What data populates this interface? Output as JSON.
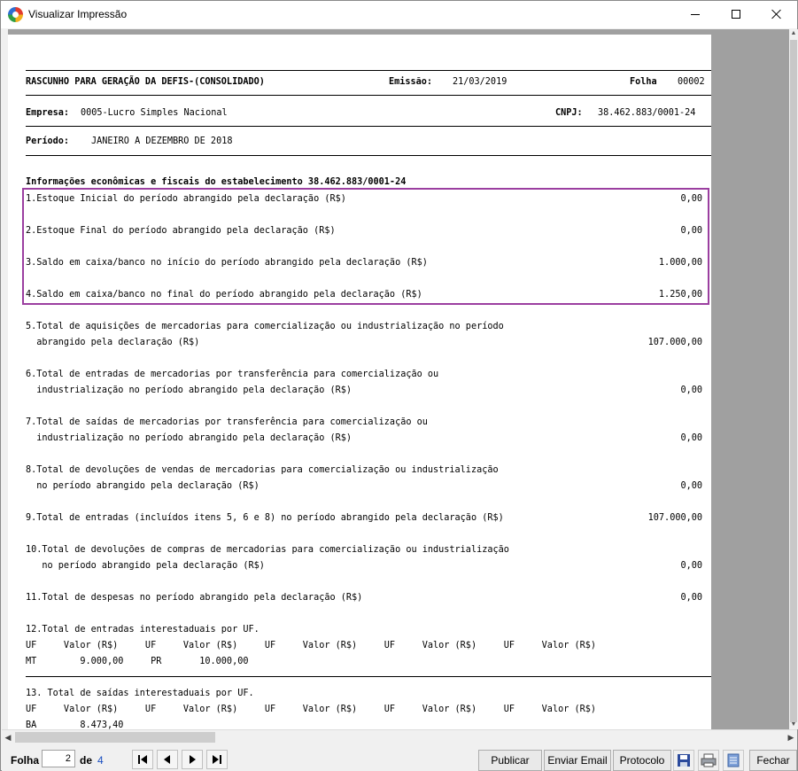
{
  "window": {
    "title": "Visualizar Impressão"
  },
  "report": {
    "header": {
      "title": "RASCUNHO PARA GERAÇÃO DA DEFIS-(CONSOLIDADO)",
      "emissao_label": "Emissão:",
      "emissao_value": "21/03/2019",
      "folha_label": "Folha",
      "folha_value": "00002",
      "empresa_label": "Empresa:",
      "empresa_value": "0005-Lucro Simples Nacional",
      "cnpj_label": "CNPJ:",
      "cnpj_value": "38.462.883/0001-24",
      "periodo_label": "Período:",
      "periodo_value": "JANEIRO A DEZEMBRO DE 2018"
    },
    "section_title": "Informações econômicas e fiscais do estabelecimento 38.462.883/0001-24",
    "items": [
      {
        "line1": "1.Estoque Inicial do período abrangido pela declaração (R$)",
        "line2": "",
        "value": "0,00"
      },
      {
        "line1": "2.Estoque Final do período abrangido pela declaração (R$)",
        "line2": "",
        "value": "0,00"
      },
      {
        "line1": "3.Saldo em caixa/banco no início do período abrangido pela declaração (R$)",
        "line2": "",
        "value": "1.000,00"
      },
      {
        "line1": "4.Saldo em caixa/banco no final do período abrangido pela declaração (R$)",
        "line2": "",
        "value": "1.250,00"
      },
      {
        "line1": "5.Total de aquisições de mercadorias para comercialização ou industrialização no período",
        "line2": "  abrangido pela declaração (R$)",
        "value": "107.000,00"
      },
      {
        "line1": "6.Total de entradas de mercadorias por transferência para comercialização ou",
        "line2": "  industrialização no período abrangido pela declaração (R$)",
        "value": "0,00"
      },
      {
        "line1": "7.Total de saídas de mercadorias por transferência para comercialização ou",
        "line2": "  industrialização no período abrangido pela declaração (R$)",
        "value": "0,00"
      },
      {
        "line1": "8.Total de devoluções de vendas de mercadorias para comercialização ou industrialização",
        "line2": "  no período abrangido pela declaração (R$)",
        "value": "0,00"
      },
      {
        "line1": "9.Total de entradas (incluídos itens 5, 6 e 8) no período abrangido pela declaração (R$)",
        "line2": "",
        "value": "107.000,00"
      },
      {
        "line1": "10.Total de devoluções de compras de mercadorias para comercialização ou industrialização",
        "line2": "   no período abrangido pela declaração (R$)",
        "value": "0,00"
      },
      {
        "line1": "11.Total de despesas no período abrangido pela declaração (R$)",
        "line2": "",
        "value": "0,00"
      }
    ],
    "uf_entradas": {
      "title": "12.Total de entradas interestaduais por UF.",
      "header": "UF     Valor (R$)     UF     Valor (R$)     UF     Valor (R$)     UF     Valor (R$)     UF     Valor (R$)",
      "rows": [
        "MT        9.000,00     PR       10.000,00"
      ]
    },
    "uf_saidas": {
      "title": "13. Total de saídas interestaduais por UF.",
      "header": "UF     Valor (R$)     UF     Valor (R$)     UF     Valor (R$)     UF     Valor (R$)     UF     Valor (R$)",
      "rows": [
        "BA        8.473,40"
      ]
    }
  },
  "toolbar": {
    "folha_label": "Folha",
    "current_page": "2",
    "de_label": "de",
    "total_pages": "4",
    "publicar": "Publicar",
    "enviar_email": "Enviar Email",
    "protocolo": "Protocolo",
    "fechar": "Fechar"
  }
}
